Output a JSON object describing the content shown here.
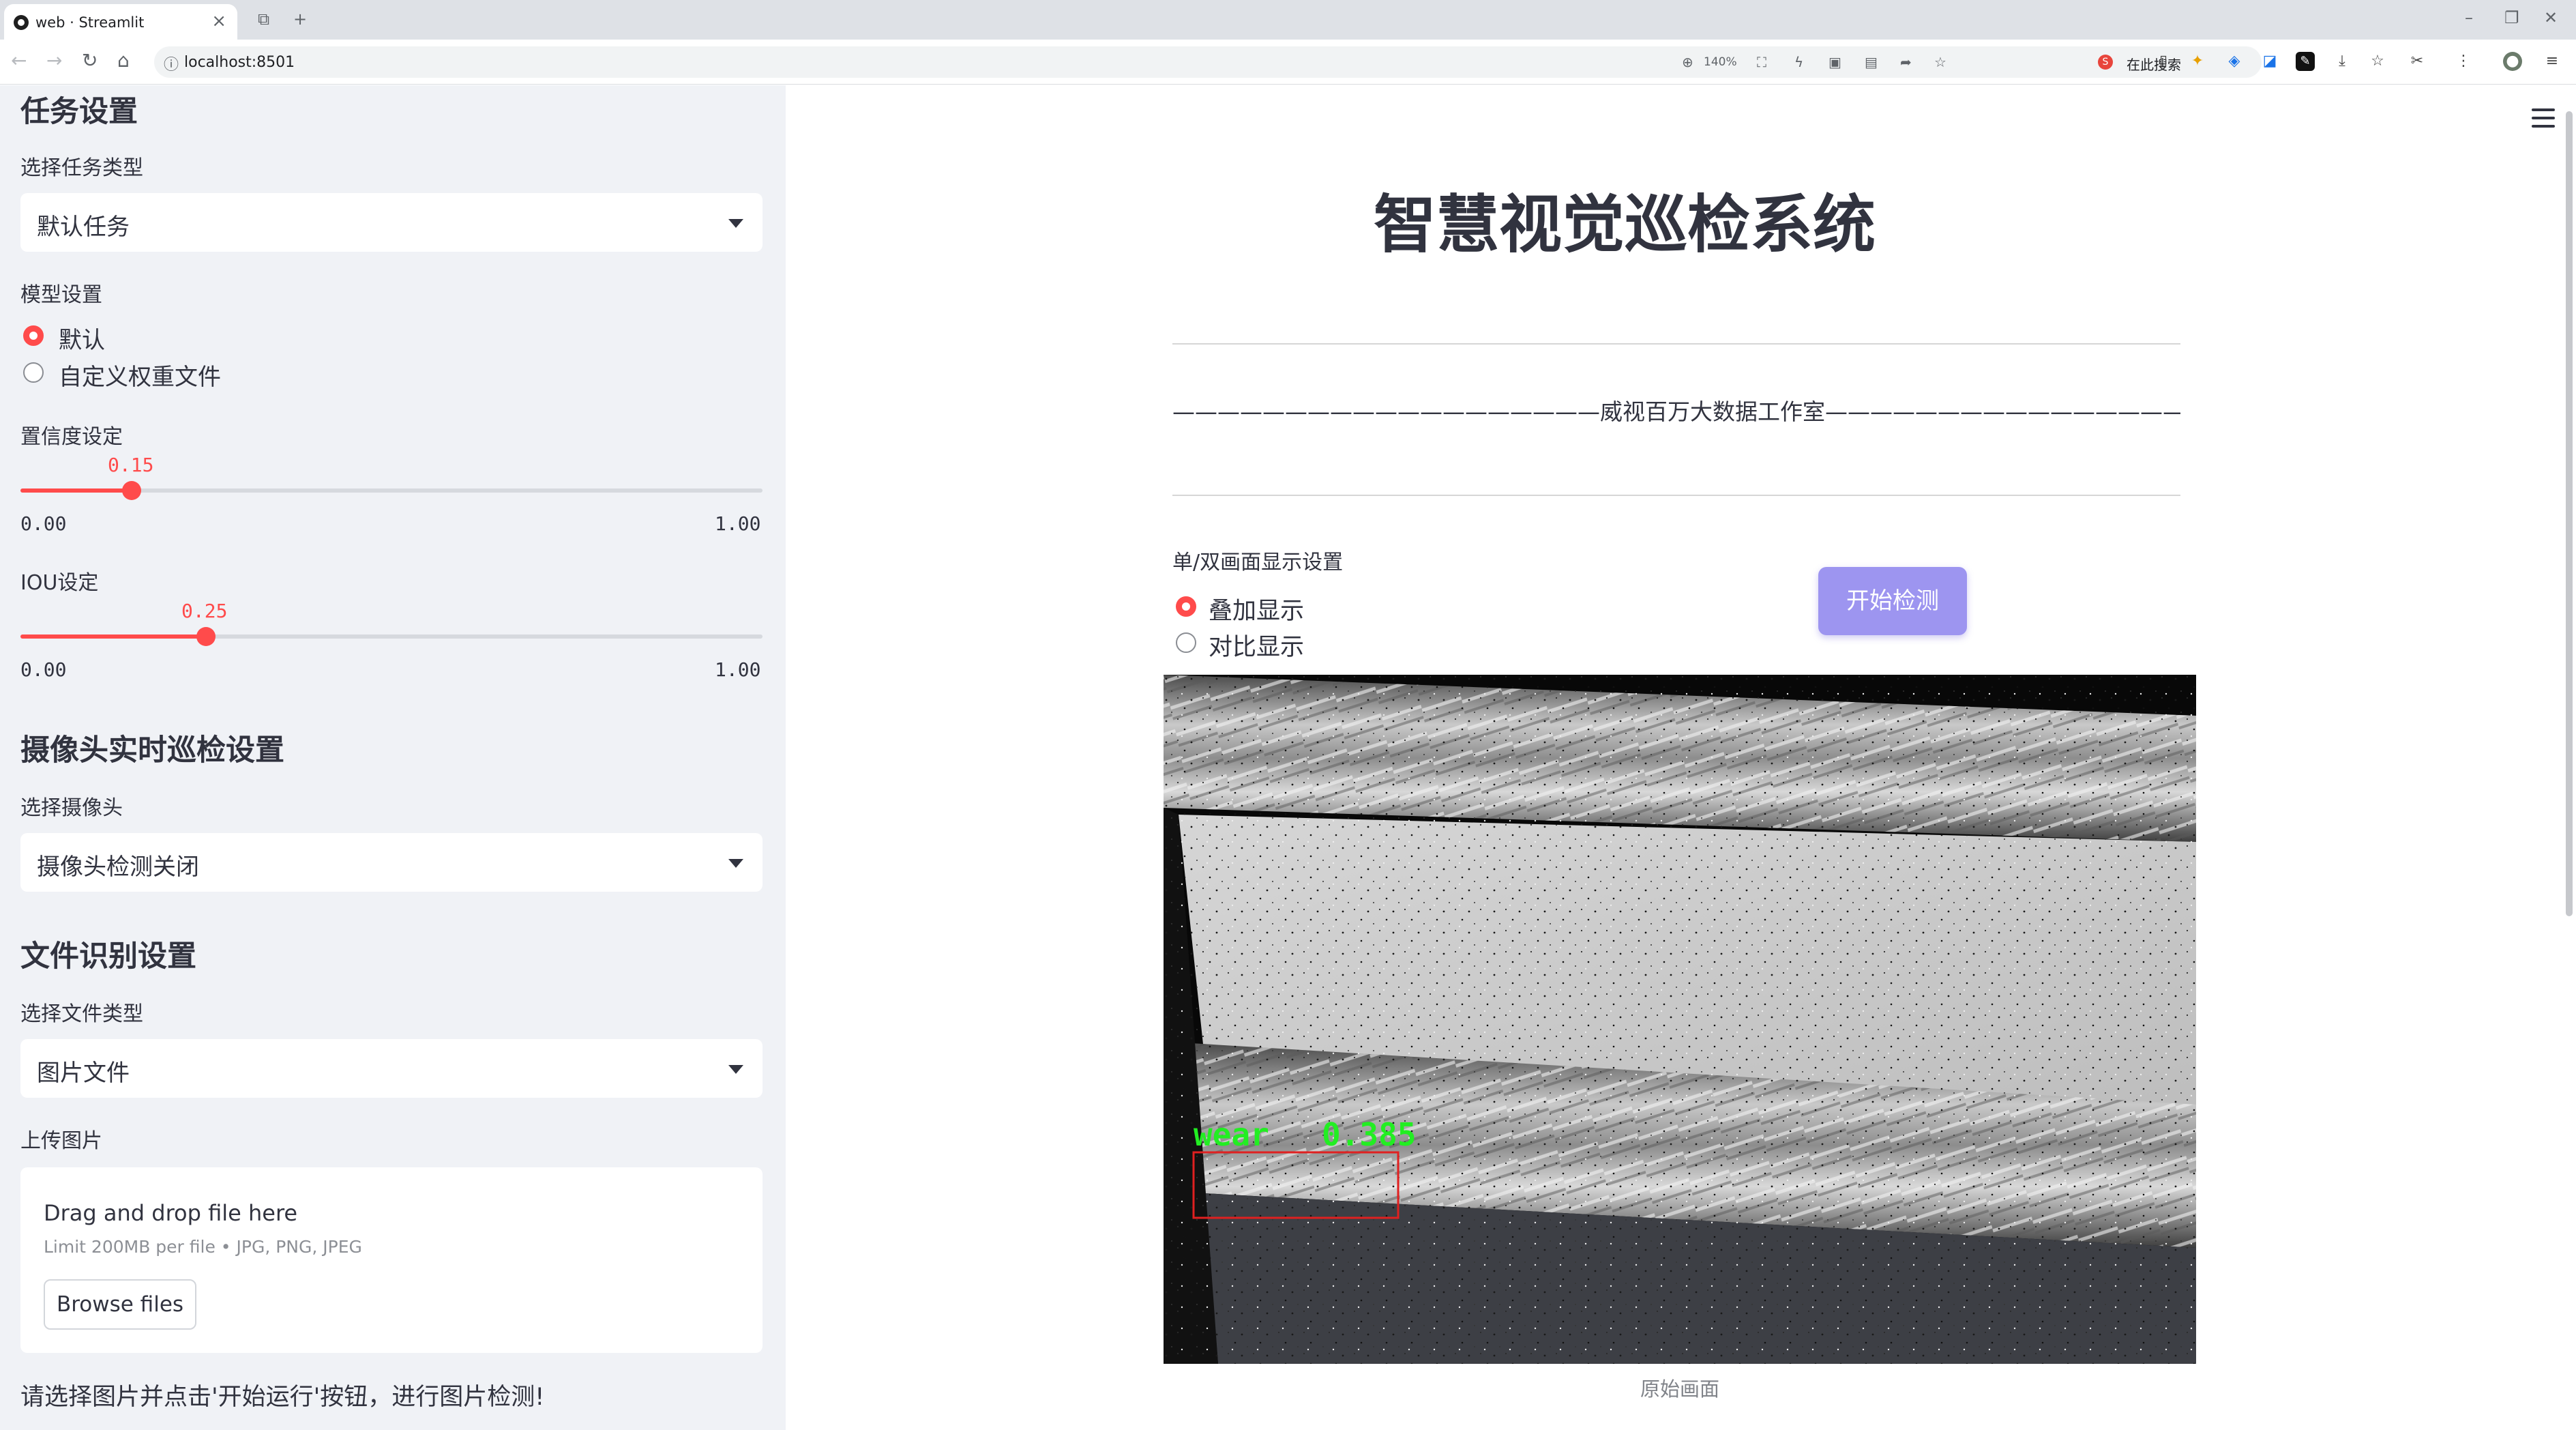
{
  "browser": {
    "tab_title": "web · Streamlit",
    "url": "localhost:8501",
    "zoom": "140%",
    "search_box": "在此搜索"
  },
  "sidebar": {
    "task_section": "任务设置",
    "task_type_label": "选择任务类型",
    "task_type_value": "默认任务",
    "model_label": "模型设置",
    "model_options": [
      "默认",
      "自定义权重文件"
    ],
    "model_selected": "默认",
    "conf_label": "置信度设定",
    "conf_value": "0.15",
    "conf_fraction": 0.15,
    "iou_label": "IOU设定",
    "iou_value": "0.25",
    "iou_fraction": 0.25,
    "slider_min": "0.00",
    "slider_max": "1.00",
    "camera_section": "摄像头实时巡检设置",
    "camera_label": "选择摄像头",
    "camera_value": "摄像头检测关闭",
    "file_section": "文件识别设置",
    "file_type_label": "选择文件类型",
    "file_type_value": "图片文件",
    "upload_label": "上传图片",
    "upload_title": "Drag and drop file here",
    "upload_limit": "Limit 200MB per file • JPG, PNG, JPEG",
    "browse_label": "Browse files",
    "note": "请选择图片并点击'开始运行'按钮，进行图片检测!"
  },
  "main": {
    "title": "智慧视觉巡检系统",
    "studio_line": "———————————————————威视百万大数据工作室——————————————————————",
    "display_label": "单/双画面显示设置",
    "display_options": [
      "叠加显示",
      "对比显示"
    ],
    "display_selected": "叠加显示",
    "start_button": "开始检测",
    "image_caption": "原始画面",
    "detection": {
      "label": "wear",
      "score": "0.385",
      "box_color": "#e02020",
      "text_color": "#22ee22"
    }
  },
  "colors": {
    "accent": "#ff4b4b",
    "button": "#9d95f0",
    "sidebar_bg": "#f0f2f6"
  }
}
